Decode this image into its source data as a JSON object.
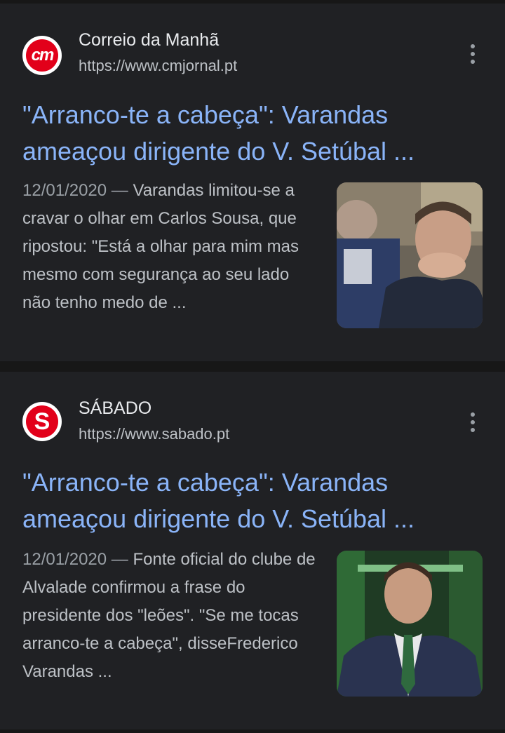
{
  "results": [
    {
      "source": "Correio da Manhã",
      "url": "https://www.cmjornal.pt",
      "logo_text": "cm",
      "title": "\"Arranco-te a cabeça\": Varandas ameaçou dirigente do V. Setúbal ...",
      "date": "12/01/2020",
      "dash": " — ",
      "snippet": "Varandas limitou-se a cravar o olhar em Carlos Sousa, que ripostou: \"Está a olhar para mim mas mesmo com segurança ao seu lado não tenho medo de ..."
    },
    {
      "source": "SÁBADO",
      "url": "https://www.sabado.pt",
      "logo_text": "S",
      "title": "\"Arranco-te a cabeça\": Varandas ameaçou dirigente do V. Setúbal ...",
      "date": "12/01/2020",
      "dash": " — ",
      "snippet": "Fonte oficial do clube de Alvalade confirmou a frase do presidente dos \"leões\". \"Se me tocas arranco-te a cabeça\", disseFrederico Varandas ..."
    }
  ],
  "colors": {
    "background": "#171717",
    "card": "#202124",
    "link": "#8ab4f8",
    "text": "#e8eaed",
    "secondary": "#bdc1c6",
    "logo_red": "#e2001a"
  },
  "icons": {
    "menu": "more-vert-icon"
  }
}
